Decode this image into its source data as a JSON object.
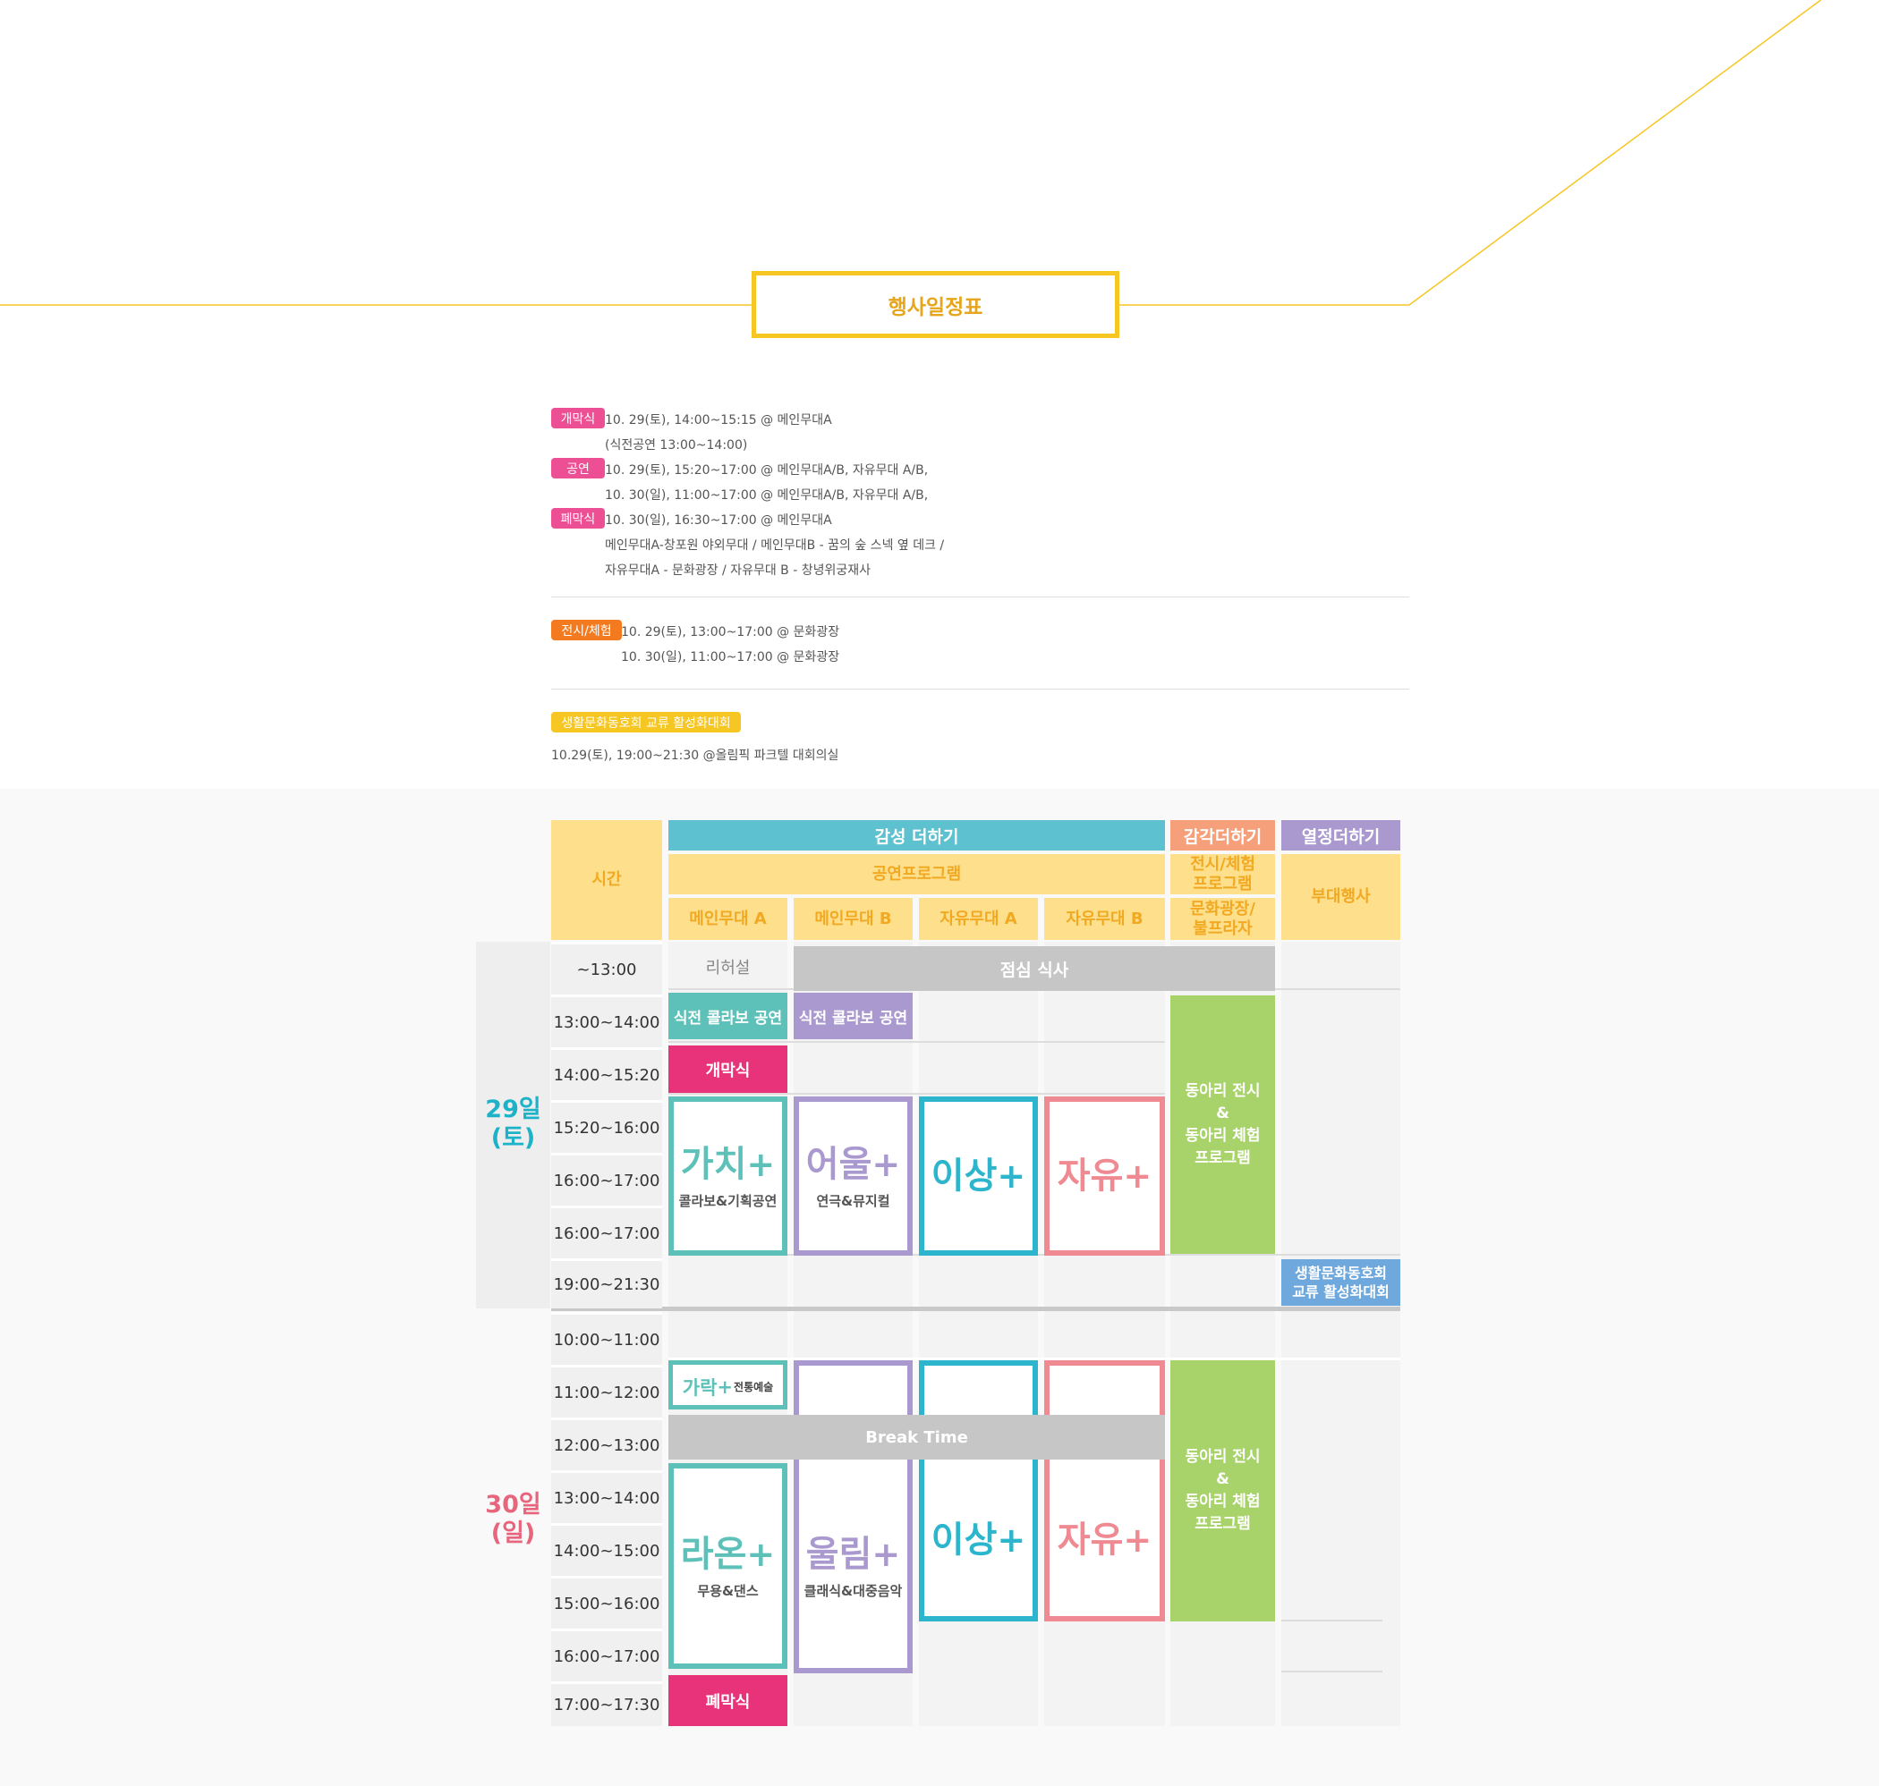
{
  "page_title": "행사일정표",
  "info": {
    "opening": {
      "badge": "개막식",
      "lines": [
        "10. 29(토), 14:00~15:15 @ 메인무대A",
        "(식전공연 13:00~14:00)"
      ]
    },
    "performance": {
      "badge": "공연",
      "lines": [
        "10. 29(토), 15:20~17:00 @ 메인무대A/B, 자유무대 A/B,",
        "10. 30(일), 11:00~17:00 @ 메인무대A/B, 자유무대 A/B,"
      ]
    },
    "closing": {
      "badge": "폐막식",
      "lines": [
        "10. 30(일), 16:30~17:00 @ 메인무대A",
        "메인무대A-창포원 야외무대 / 메인무대B - 꿈의 숲 스넥 옆 데크 /",
        "자유무대A - 문화광장 / 자유무대 B - 창녕위궁재사"
      ]
    },
    "exhibition": {
      "badge": "전시/체험",
      "lines": [
        "10. 29(토), 13:00~17:00 @ 문화광장",
        "10. 30(일), 11:00~17:00 @ 문화광장"
      ]
    },
    "club": {
      "badge": "생활문화동호회 교류 활성화대회",
      "line": "10.29(토), 19:00~21:30 @올림픽 파크텔 대회의실"
    }
  },
  "colors": {
    "accent_yellow": "#f6c623",
    "pink": "#ec4f93",
    "orange": "#f47a1f",
    "teal": "#5dc1cf",
    "salmon": "#f5a07a",
    "purple": "#a999cf",
    "green": "#a8d26a",
    "magenta": "#e8327a",
    "cyan_box": "#2cb5cc",
    "rose_box": "#ef8a92",
    "blue_box": "#6fa8dc",
    "day1": "#1cb3c8",
    "day2": "#e8657e"
  },
  "table": {
    "time_header": "시간",
    "group1": "감성 더하기",
    "group2": "감각더하기",
    "group3": "열정더하기",
    "sub1": "공연프로그램",
    "sub2": "전시/체험\n프로그램",
    "sub3": "부대행사",
    "stages": [
      "메인무대 A",
      "메인무대 B",
      "자유무대 A",
      "자유무대 B"
    ],
    "culture_plaza": "문화광장/\n불프라자",
    "days": [
      "29일\n(토)",
      "30일\n(일)"
    ],
    "times_day1": [
      "~13:00",
      "13:00~14:00",
      "14:00~15:20",
      "15:20~16:00",
      "16:00~17:00",
      "16:00~17:00",
      "19:00~21:30"
    ],
    "times_day2": [
      "10:00~11:00",
      "11:00~12:00",
      "12:00~13:00",
      "13:00~14:00",
      "14:00~15:00",
      "15:00~16:00",
      "16:00~17:00",
      "17:00~17:30"
    ],
    "rehearsal": "리허설",
    "lunch": "점심 식사",
    "pre_collab": "식전 콜라보 공연",
    "opening": "개막식",
    "closing": "폐막식",
    "break_time": "Break Time",
    "exhibit": "동아리 전시\n&\n동아리 체험\n프로그램",
    "club_event": "생활문화동호회\n교류 활성화대회",
    "gachi": {
      "name": "가치",
      "sub": "콜라보&기획공연"
    },
    "eoul": {
      "name": "어울",
      "sub": "연극&뮤지컬"
    },
    "isang": {
      "name": "이상"
    },
    "jayu": {
      "name": "자유"
    },
    "garak": {
      "name": "가락",
      "sub": "전통예술"
    },
    "raon": {
      "name": "라온",
      "sub": "무용&댄스"
    },
    "ullim": {
      "name": "울림",
      "sub": "클래식&대중음악"
    },
    "plus": "+"
  }
}
